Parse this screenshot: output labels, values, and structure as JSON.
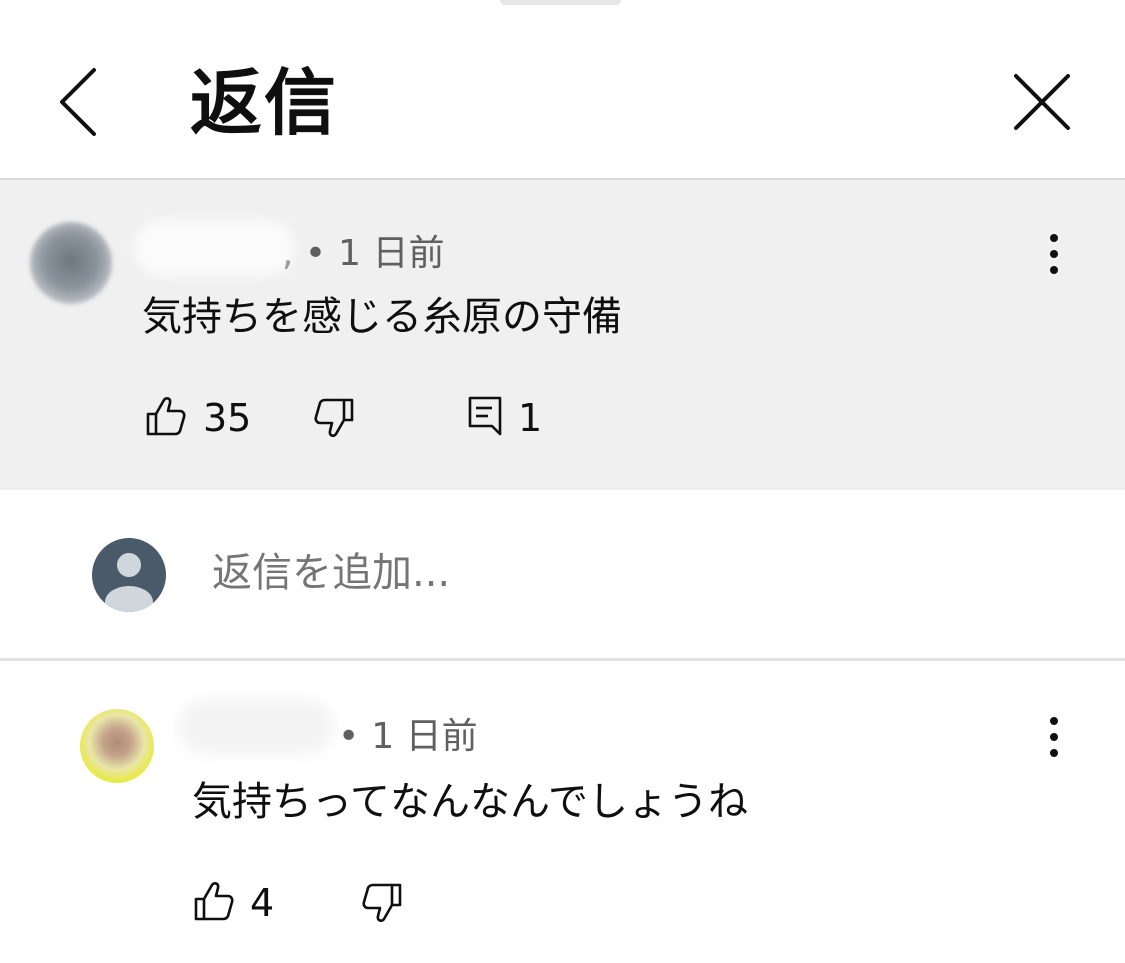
{
  "header": {
    "title": "返信"
  },
  "parent_comment": {
    "time": "1 日前",
    "text": "気持ちを感じる糸原の守備",
    "likes": "35",
    "replies": "1"
  },
  "reply_box": {
    "placeholder": "返信を追加..."
  },
  "reply_comment": {
    "time": "1 日前",
    "text": "気持ちってなんなんでしょうね",
    "likes": "4"
  },
  "colors": {
    "parent_background": "#f0f0f0",
    "secondary_text": "#606060",
    "avatar_default": "#4b5a68"
  },
  "icons": [
    "back-chevron-icon",
    "close-icon",
    "more-vert-icon",
    "thumbs-up-icon",
    "thumbs-down-icon",
    "comment-icon",
    "default-avatar-icon"
  ]
}
